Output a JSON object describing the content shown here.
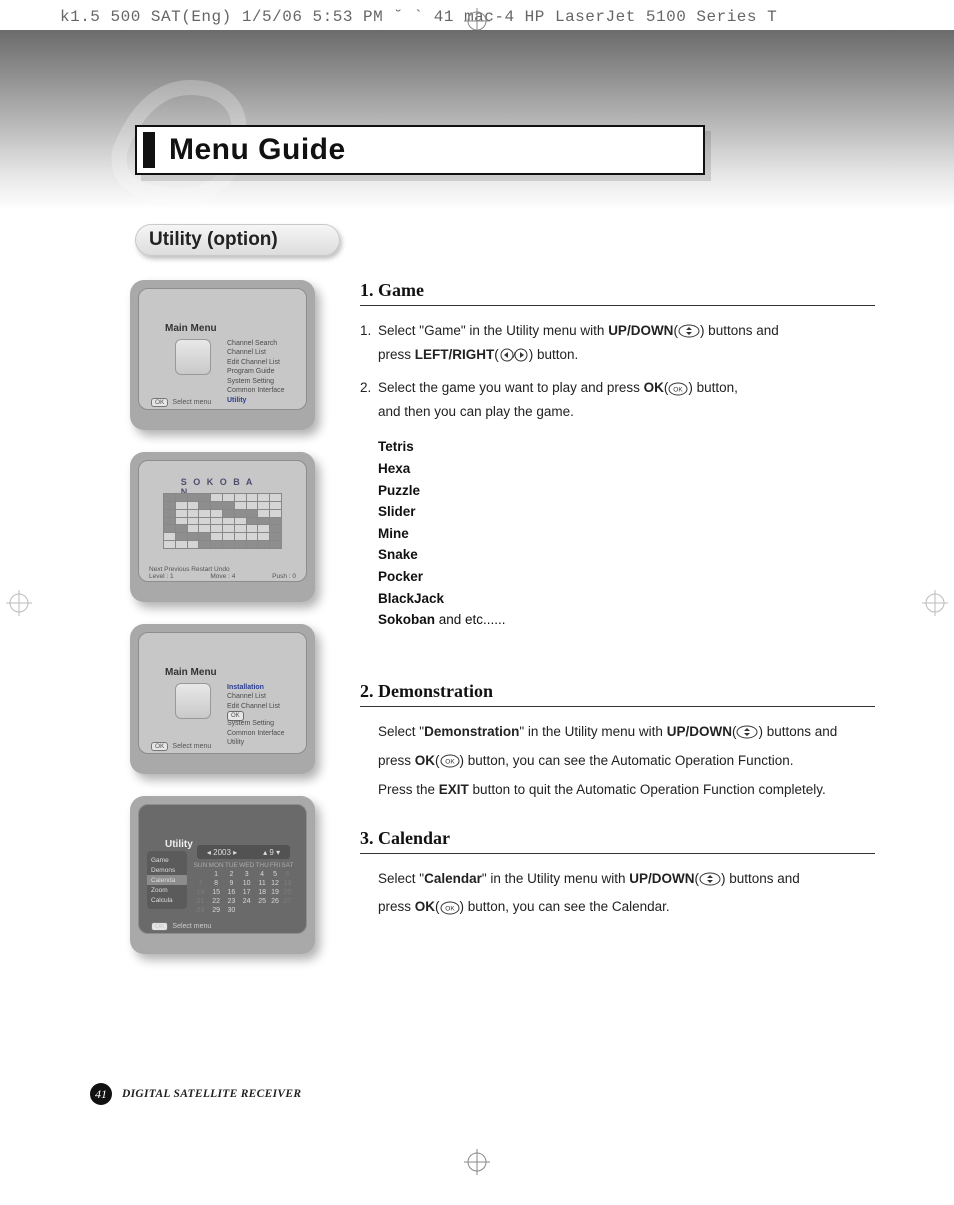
{
  "print_meta": "k1.5 500 SAT(Eng)  1/5/06 5:53 PM  ˘  `  41   mac-4 HP LaserJet 5100 Series  T",
  "title": "Menu Guide",
  "section": "Utility (option)",
  "shot1": {
    "title": "Main Menu",
    "items": [
      "Channel Search",
      "Channel List",
      "Edit Channel List",
      "Program Guide",
      "System Setting",
      "Common Interface",
      "Utility"
    ],
    "status_ok": "OK",
    "status": "Select menu"
  },
  "shot2": {
    "title": "S O K O B A N",
    "bottom_left": "Next     Previous     Restart     Undo",
    "bottom_right": "",
    "bottom2_left": "Level : 1",
    "bottom2_mid": "Move : 4",
    "bottom2_right": "Push : 0"
  },
  "shot3": {
    "title": "Main Menu",
    "items": [
      "Installation",
      "Channel List",
      "Edit Channel List",
      "",
      "System Setting",
      "Common Interface",
      "Utility"
    ],
    "status_ok": "OK",
    "status": "Select menu",
    "ok_badge": "OK"
  },
  "shot4": {
    "title": "Utility",
    "sidebar": [
      "Game",
      "Demons",
      "Calenda",
      "Zoom",
      "Calcula"
    ],
    "year": "2003",
    "month": "9",
    "dow": [
      "SUN",
      "MON",
      "TUE",
      "WED",
      "THU",
      "FRI",
      "SAT"
    ],
    "grid": [
      [
        "",
        "1",
        "2",
        "3",
        "4",
        "5",
        "6"
      ],
      [
        "7",
        "8",
        "9",
        "10",
        "11",
        "12",
        "13"
      ],
      [
        "14",
        "15",
        "16",
        "17",
        "18",
        "19",
        "20"
      ],
      [
        "21",
        "22",
        "23",
        "24",
        "25",
        "26",
        "27"
      ],
      [
        "28",
        "29",
        "30",
        "",
        "",
        "",
        ""
      ]
    ],
    "dim_cols_first_row_last": true,
    "status_ok": "OK",
    "status": "Select menu"
  },
  "game": {
    "heading": "1. Game",
    "step1_a": "Select \"Game\" in the Utility menu with ",
    "step1_b_bold": "UP/DOWN",
    "step1_c": "(",
    "step1_d": ") buttons and",
    "step1_line2_a": "press ",
    "step1_line2_b_bold": "LEFT/RIGHT",
    "step1_line2_c": "(",
    "step1_line2_d": ") button.",
    "step2_a": "Select the game you want to play and press ",
    "step2_b_bold": "OK",
    "step2_c": "(",
    "step2_d": ") button,",
    "step2_line2": "and then you can play the game.",
    "list": [
      "Tetris",
      "Hexa",
      "Puzzle",
      "Slider",
      "Mine",
      "Snake",
      "Pocker",
      "BlackJack"
    ],
    "list_last_bold": "Sokoban",
    "list_last_tail": " and etc......"
  },
  "demo": {
    "heading": "2. Demonstration",
    "p1_a": "Select \"",
    "p1_b_bold": "Demonstration",
    "p1_c": "\" in the Utility menu with ",
    "p1_d_bold": "UP/DOWN",
    "p1_e": "(",
    "p1_f": ") buttons and",
    "p2_a": "press ",
    "p2_b_bold": "OK",
    "p2_c": "(",
    "p2_d": ") button, you can see the Automatic Operation Function.",
    "p3_a": "Press the ",
    "p3_b_bold": "EXIT",
    "p3_c": " button to quit the Automatic Operation Function completely."
  },
  "calendar": {
    "heading": "3. Calendar",
    "p1_a": "Select \"",
    "p1_b_bold": "Calendar",
    "p1_c": "\" in the Utility menu with ",
    "p1_d_bold": "UP/DOWN",
    "p1_e": "(",
    "p1_f": ") buttons and",
    "p2_a": "press ",
    "p2_b_bold": "OK",
    "p2_c": "(",
    "p2_d": ") button, you can see the Calendar."
  },
  "footer": {
    "page": "41",
    "text": "DIGITAL SATELLITE RECEIVER"
  }
}
